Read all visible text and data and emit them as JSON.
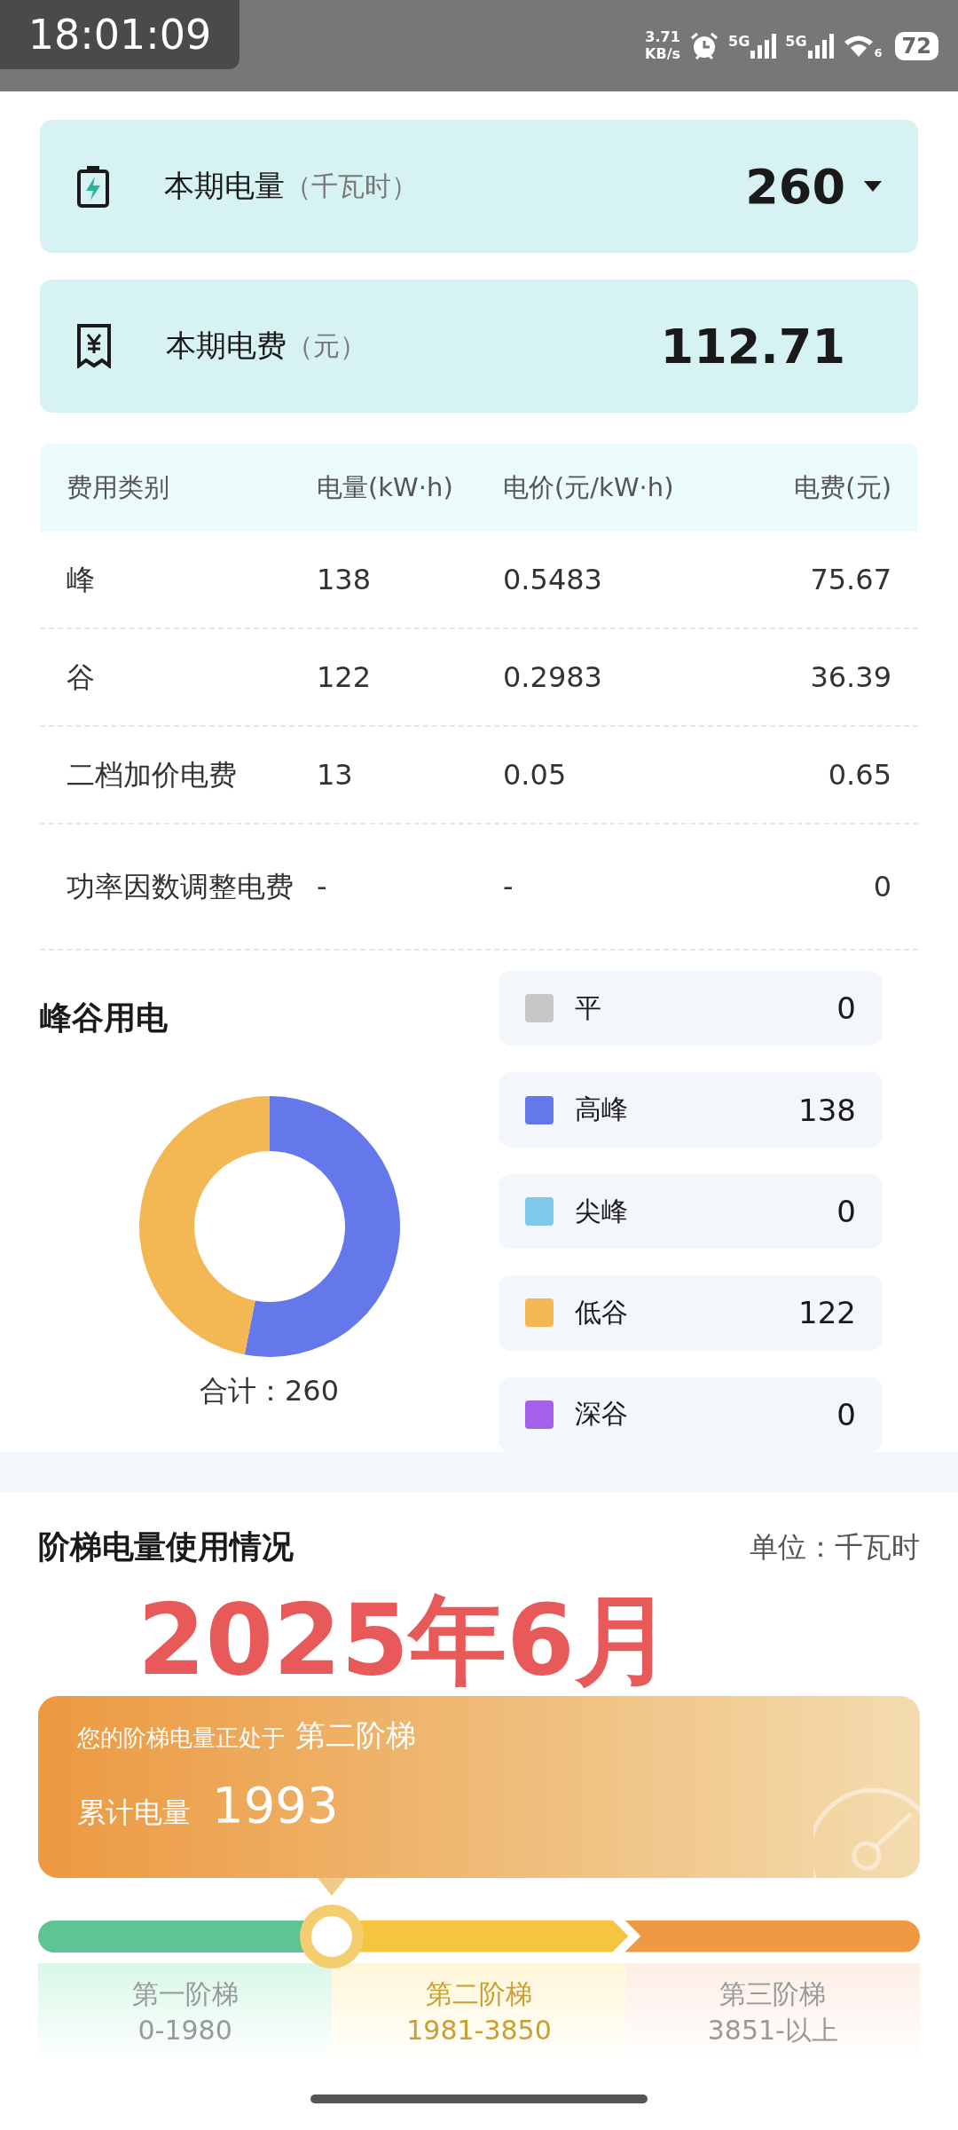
{
  "status_bar": {
    "time": "18:01:09",
    "net_speed": "3.71",
    "net_unit": "KB/s",
    "signals": [
      "5G",
      "5G"
    ],
    "wifi_band": "6",
    "battery": "72"
  },
  "summary": [
    {
      "kind": "energy",
      "title": "本期电量",
      "unit": "（千瓦时）",
      "value": "260",
      "dropdown": true
    },
    {
      "kind": "bill",
      "title": "本期电费",
      "unit": "（元）",
      "value": "112.71",
      "dropdown": false
    }
  ],
  "fee_table": {
    "columns": [
      "费用类别",
      "电量(kW·h)",
      "电价(元/kW·h)",
      "电费(元)"
    ],
    "rows": [
      [
        "峰",
        "138",
        "0.5483",
        "75.67"
      ],
      [
        "谷",
        "122",
        "0.2983",
        "36.39"
      ],
      [
        "二档加价电费",
        "13",
        "0.05",
        "0.65"
      ],
      [
        "功率因数调整电费",
        "-",
        "-",
        "0"
      ]
    ]
  },
  "peak_valley": {
    "title": "峰谷用电",
    "total": "合计：260",
    "chart_data": {
      "type": "donut",
      "categories": [
        "平",
        "高峰",
        "尖峰",
        "低谷",
        "深谷"
      ],
      "values": [
        0,
        53.08,
        0,
        46.92,
        0
      ]
    },
    "legend": [
      {
        "value": "0",
        "color": "#c8c8c8"
      },
      {
        "value": "138",
        "color": "#6478ec"
      },
      {
        "value": "0",
        "color": "#7ec8ec"
      },
      {
        "value": "122",
        "color": "#f3b853"
      },
      {
        "value": "0",
        "color": "#a460e8"
      }
    ]
  },
  "tier_usage": {
    "title": "阶梯电量使用情况",
    "unit": "单位：千瓦时",
    "status_prefix": "您的阶梯电量正处于",
    "status_tier": "第二阶梯",
    "total_label": "累计电量",
    "total_value": "1993",
    "tiers": [
      {
        "name": "第一阶梯",
        "range": "0-1980",
        "selected": false
      },
      {
        "name": "第二阶梯",
        "range": "1981-3850",
        "selected": true
      },
      {
        "name": "第三阶梯",
        "range": "3851-以上",
        "selected": false
      }
    ]
  },
  "annotation": "2025年6月"
}
